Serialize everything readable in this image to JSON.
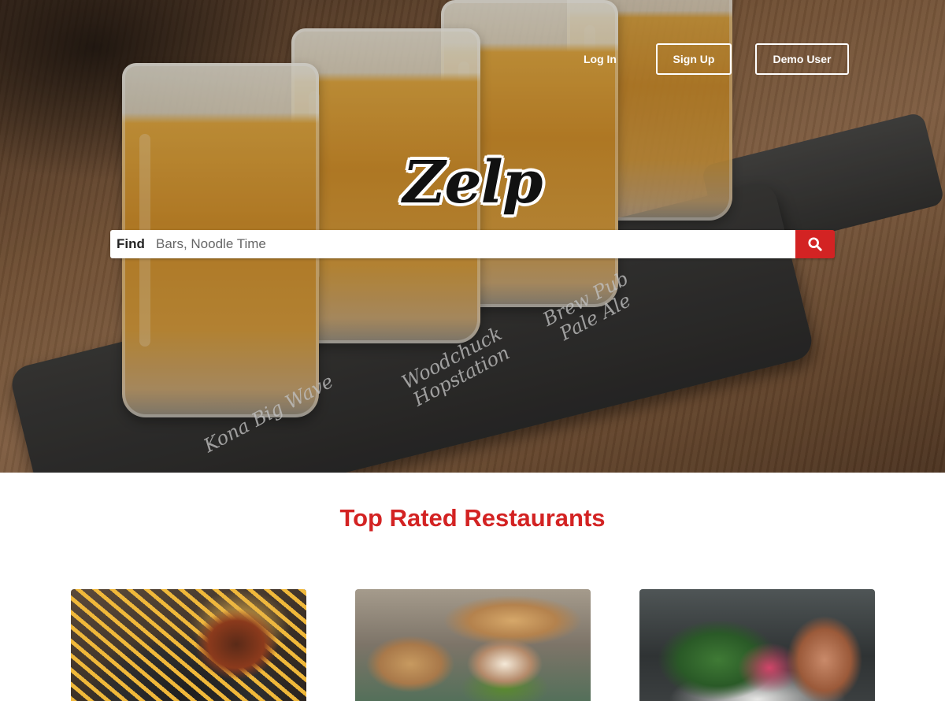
{
  "nav": {
    "login_label": "Log In",
    "signup_label": "Sign Up",
    "demo_label": "Demo User"
  },
  "hero": {
    "logo_text": "Zelp",
    "search": {
      "label": "Find",
      "placeholder": "Bars, Noodle Time",
      "button_icon": "search-icon"
    },
    "chalk_labels": [
      "Kona Big Wave",
      "Woodchuck Hopstation",
      "Brew Pub Pale Ale"
    ]
  },
  "main": {
    "section_title": "Top Rated Restaurants",
    "cards": [
      {
        "image": "burger-and-fries-photo"
      },
      {
        "image": "sandwich-photo"
      },
      {
        "image": "salad-sandwich-photo"
      }
    ]
  },
  "colors": {
    "brand_red": "#d32323",
    "white": "#ffffff"
  }
}
